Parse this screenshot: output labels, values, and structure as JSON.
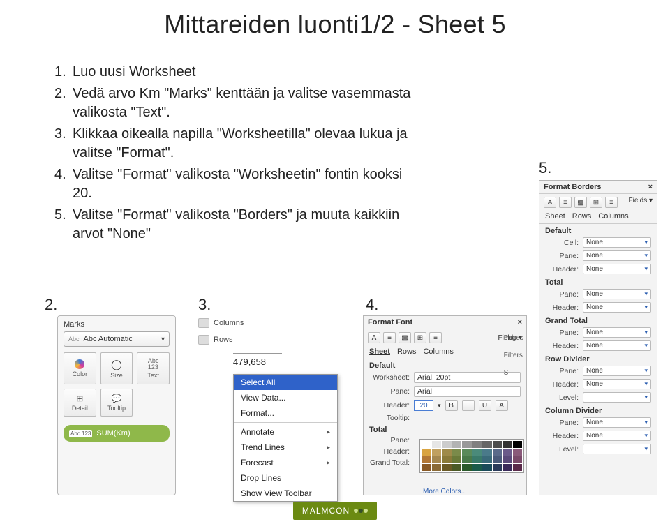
{
  "title": "Mittareiden luonti1/2 - Sheet 5",
  "instructions": [
    {
      "n": "1.",
      "t": "Luo uusi Worksheet"
    },
    {
      "n": "2.",
      "t": "Vedä arvo Km \"Marks\" kenttään ja valitse vasemmasta valikosta \"Text\"."
    },
    {
      "n": "3.",
      "t": "Klikkaa oikealla napilla \"Worksheetilla\" olevaa lukua ja valitse \"Format\"."
    },
    {
      "n": "4.",
      "t": "Valitse \"Format\" valikosta \"Worksheetin\" fontin kooksi 20."
    },
    {
      "n": "5.",
      "t": "Valitse \"Format\" valikosta \"Borders\" ja muuta kaikkiin arvot \"None\""
    }
  ],
  "callouts": {
    "c2": "2.",
    "c3": "3.",
    "c4": "4.",
    "c5": "5."
  },
  "marks": {
    "header": "Marks",
    "type_label": "Abc Automatic",
    "cells": [
      "Color",
      "Size",
      "Text",
      "Detail",
      "Tooltip"
    ],
    "pill": "SUM(Km)",
    "pill_abc": "Abc\n123"
  },
  "context": {
    "shelf_columns": "Columns",
    "shelf_rows": "Rows",
    "big_number": "479,658",
    "items": [
      "Select All",
      "View Data...",
      "Format...",
      "Annotate",
      "Trend Lines",
      "Forecast",
      "Drop Lines",
      "Show View Toolbar"
    ]
  },
  "format_font": {
    "title": "Format Font",
    "close": "×",
    "fields_btn": "Fields ▾",
    "tabs": [
      "Sheet",
      "Rows",
      "Columns"
    ],
    "section_default": "Default",
    "rows": {
      "worksheet_lbl": "Worksheet:",
      "worksheet_val": "Arial, 20pt",
      "pane_lbl": "Pane:",
      "pane_val": "Arial",
      "header_lbl": "Header:",
      "header_size": "20",
      "tooltip_lbl": "Tooltip:"
    },
    "section_total": "Total",
    "total_rows": {
      "pane_lbl": "Pane:",
      "header_lbl": "Header:",
      "grand_lbl": "Grand Total:"
    },
    "side_labels": [
      "Pages",
      "Filters",
      "S"
    ],
    "biua": [
      "B",
      "I",
      "U",
      "A"
    ],
    "more_colors": "More Colors..",
    "swatch_colors": [
      "#fff",
      "#e6e6e6",
      "#ccc",
      "#b3b3b3",
      "#999",
      "#808080",
      "#666",
      "#4d4d4d",
      "#333",
      "#000",
      "#d9a441",
      "#c0a060",
      "#9e8a4a",
      "#7a8a4a",
      "#5a8a5a",
      "#4a8a7a",
      "#4a7a8a",
      "#5a6a8a",
      "#6a5a8a",
      "#8a5a7a",
      "#b37836",
      "#a58850",
      "#8a7a3a",
      "#6a7a3a",
      "#4a7a4a",
      "#3a7a6a",
      "#3a6a7a",
      "#4a5a7a",
      "#5a4a7a",
      "#7a4a6a",
      "#8a5a26",
      "#8a6a36",
      "#6a5a26",
      "#4a5a26",
      "#2a5a2a",
      "#1a5a4a",
      "#1a4a5a",
      "#2a3a5a",
      "#3a2a5a",
      "#5a2a4a"
    ]
  },
  "format_borders": {
    "title": "Format Borders",
    "close": "×",
    "tabs": [
      "Sheet",
      "Rows",
      "Columns"
    ],
    "section_default": "Default",
    "none": "None",
    "labels": {
      "cell": "Cell:",
      "pane": "Pane:",
      "header": "Header:",
      "total": "Total",
      "grand": "Grand Total",
      "rowdiv": "Row Divider",
      "coldiv": "Column Divider",
      "level": "Level:"
    },
    "fields_btn": "Fields ▾"
  },
  "logo": "MALMCON"
}
